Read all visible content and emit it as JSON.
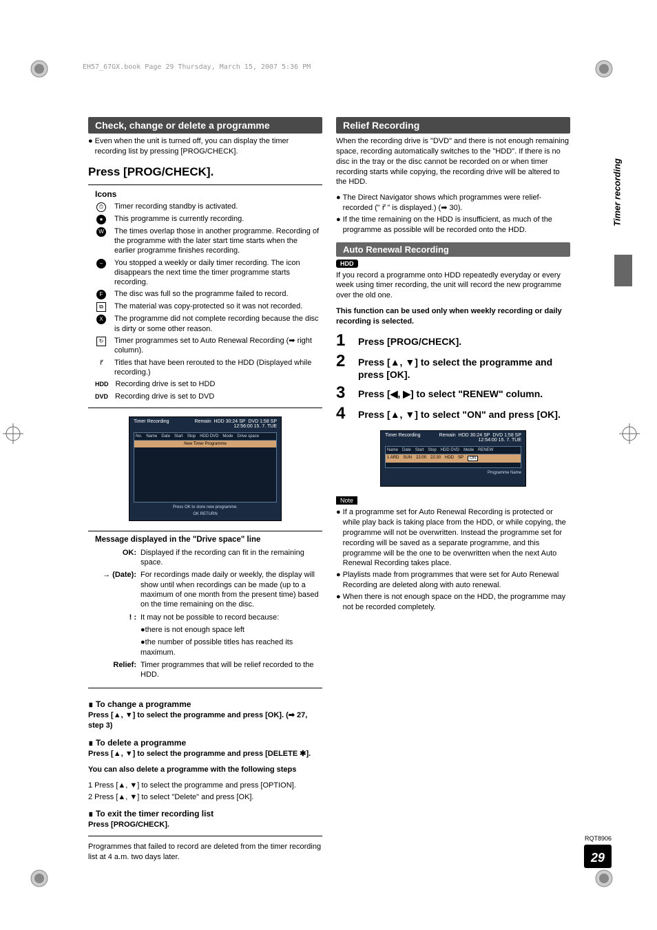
{
  "print_header": "EH57_67GX.book  Page 29  Thursday, March 15, 2007  5:36 PM",
  "side_label": "Timer recording",
  "doc_code": "RQT8906",
  "page_number": "29",
  "left": {
    "bar1": "Check, change or delete a programme",
    "intro1": "Even when the unit is turned off, you can display the timer recording list by pressing [PROG/CHECK].",
    "press_heading": "Press [PROG/CHECK].",
    "icons_title": "Icons",
    "icons": [
      {
        "label": "clock",
        "text": "Timer recording standby is activated."
      },
      {
        "label": "rec",
        "text": "This programme is currently recording."
      },
      {
        "label": "W",
        "text": "The times overlap those in another programme. Recording of the programme with the later start time starts when the earlier programme finishes recording."
      },
      {
        "label": "pause",
        "text": "You stopped a weekly or daily timer recording. The icon disappears the next time the timer programme starts recording."
      },
      {
        "label": "F",
        "text": "The disc was full so the programme failed to record."
      },
      {
        "label": "copy",
        "text": "The material was copy-protected so it was not recorded."
      },
      {
        "label": "X",
        "text": "The programme did not complete recording because the disc is dirty or some other reason."
      },
      {
        "label": "renew",
        "text": "Timer programmes set to Auto Renewal Recording (➡ right column)."
      },
      {
        "label": "relief",
        "text": "Titles that have been rerouted to the HDD (Displayed while recording.)"
      },
      {
        "label": "HDD",
        "text": "Recording drive is set to HDD"
      },
      {
        "label": "DVD",
        "text": "Recording drive is set to DVD"
      }
    ],
    "ui1": {
      "title": "Timer Recording",
      "remain": "Remain",
      "hdd": "HDD  30:24 SP",
      "dvd": "DVD  1:58 SP",
      "clock": "12:56:00  15.  7.  TUE",
      "cols": [
        "No.",
        "Name",
        "Date",
        "Start",
        "Stop",
        "HDD DVD",
        "Mode",
        "Drive space"
      ],
      "row_text": "New Timer Programme",
      "footer": "Press OK to store new programme.",
      "hint": "OK RETURN"
    },
    "driveline_title": "Message displayed in the \"Drive space\" line",
    "driveline": [
      {
        "label": "OK:",
        "text": "Displayed if the recording can fit in the remaining space."
      },
      {
        "label": "→ (Date):",
        "text": "For recordings made daily or weekly, the display will show until when recordings can be made (up to a maximum of one month from the present time) based on the time remaining on the disc."
      },
      {
        "label": "! :",
        "text": "It may not be possible to record because:"
      },
      {
        "label": "",
        "text": "●there is not enough space left"
      },
      {
        "label": "",
        "text": "●the number of possible titles has reached its maximum."
      },
      {
        "label": "Relief:",
        "text": "Timer programmes that will be relief recorded to the HDD."
      }
    ],
    "change_head": "To change a programme",
    "change_body": "Press [▲, ▼] to select the programme and press [OK]. (➡ 27, step 3)",
    "delete_head": "To delete a programme",
    "delete_body": "Press [▲, ▼] to select the programme and press [DELETE ✱].",
    "also_head": "You can also delete a programme with the following steps",
    "also_1": "1   Press [▲, ▼] to select the programme and press [OPTION].",
    "also_2": "2   Press [▲, ▼] to select \"Delete\" and press [OK].",
    "exit_head": "To exit the timer recording list",
    "exit_body": "Press [PROG/CHECK].",
    "final_note": "Programmes that failed to record are deleted from the timer recording list at 4 a.m. two days later."
  },
  "right": {
    "bar1": "Relief Recording",
    "relief_intro": "When the recording drive is \"DVD\" and there is not enough remaining space, recording automatically switches to the \"HDD\". If there is no disc in the tray or the disc cannot be recorded on or when timer recording starts while copying, the recording drive will be altered to the HDD.",
    "relief_b1": "The Direct Navigator shows which programmes were relief-recorded (\" r⃗ \" is displayed.) (➡ 30).",
    "relief_b2": "If the time remaining on the HDD is insufficient, as much of the programme as possible will be recorded onto the HDD.",
    "bar2": "Auto Renewal Recording",
    "hdd_badge": "HDD",
    "arr_intro": "If you record a programme onto HDD repeatedly everyday or every week using timer recording, the unit will record the new programme over the old one.",
    "arr_bold": "This function can be used only when weekly recording or daily recording is selected.",
    "steps": [
      "Press [PROG/CHECK].",
      "Press [▲, ▼] to select the programme and press [OK].",
      "Press [◀, ▶] to select \"RENEW\" column.",
      "Press [▲, ▼] to select \"ON\" and press [OK]."
    ],
    "ui2": {
      "title": "Timer Recording",
      "remain": "Remain",
      "hdd": "HDD  30:24 SP",
      "dvd": "DVD  1:58 SP",
      "clock": "12:54:00  15.  7.  TUE",
      "cols": [
        "Name",
        "Date",
        "Start",
        "Stop",
        "HDD DVD",
        "Mode",
        "RENEW"
      ],
      "row": [
        "1  ARD",
        "SUN",
        "22:00",
        "22:30",
        "HDD",
        "SP",
        "ON"
      ],
      "footer": "Programme Name"
    },
    "note_badge": "Note",
    "notes": [
      "If a programme set for Auto Renewal Recording is protected or while play back is taking place from the HDD, or while copying, the programme will not be overwritten. Instead the programme set for recording will be saved as a separate programme, and this programme will be the one to be overwritten when the next Auto Renewal Recording takes place.",
      "Playlists made from programmes that were set for Auto Renewal Recording are deleted along with auto renewal.",
      "When there is not enough space on the HDD, the programme may not be recorded completely."
    ]
  }
}
